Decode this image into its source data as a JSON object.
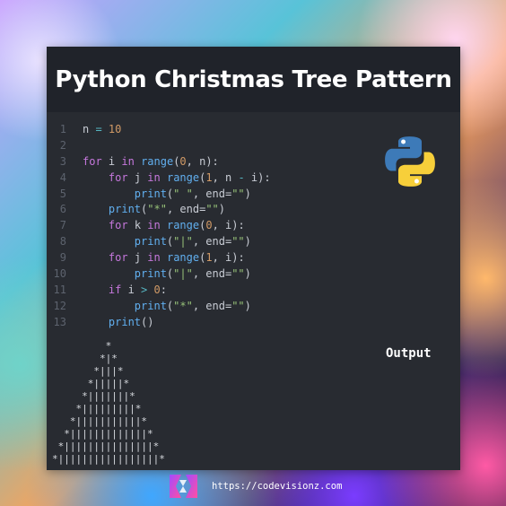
{
  "title": "Python Christmas Tree Pattern",
  "code": {
    "lines": [
      {
        "num": "1",
        "tokens": [
          {
            "t": "n ",
            "c": ""
          },
          {
            "t": "=",
            "c": "op"
          },
          {
            "t": " ",
            "c": ""
          },
          {
            "t": "10",
            "c": "num"
          }
        ]
      },
      {
        "num": "2",
        "tokens": []
      },
      {
        "num": "3",
        "tokens": [
          {
            "t": "for",
            "c": "kw"
          },
          {
            "t": " i ",
            "c": ""
          },
          {
            "t": "in",
            "c": "kw"
          },
          {
            "t": " ",
            "c": ""
          },
          {
            "t": "range",
            "c": "fn"
          },
          {
            "t": "(",
            "c": ""
          },
          {
            "t": "0",
            "c": "num"
          },
          {
            "t": ", n):",
            "c": ""
          }
        ]
      },
      {
        "num": "4",
        "tokens": [
          {
            "t": "    ",
            "c": ""
          },
          {
            "t": "for",
            "c": "kw"
          },
          {
            "t": " j ",
            "c": ""
          },
          {
            "t": "in",
            "c": "kw"
          },
          {
            "t": " ",
            "c": ""
          },
          {
            "t": "range",
            "c": "fn"
          },
          {
            "t": "(",
            "c": ""
          },
          {
            "t": "1",
            "c": "num"
          },
          {
            "t": ", n ",
            "c": ""
          },
          {
            "t": "-",
            "c": "op"
          },
          {
            "t": " i):",
            "c": ""
          }
        ]
      },
      {
        "num": "5",
        "tokens": [
          {
            "t": "        ",
            "c": ""
          },
          {
            "t": "print",
            "c": "fn"
          },
          {
            "t": "(",
            "c": ""
          },
          {
            "t": "\" \"",
            "c": "str"
          },
          {
            "t": ", end=",
            "c": ""
          },
          {
            "t": "\"\"",
            "c": "str"
          },
          {
            "t": ")",
            "c": ""
          }
        ]
      },
      {
        "num": "6",
        "tokens": [
          {
            "t": "    ",
            "c": ""
          },
          {
            "t": "print",
            "c": "fn"
          },
          {
            "t": "(",
            "c": ""
          },
          {
            "t": "\"*\"",
            "c": "str"
          },
          {
            "t": ", end=",
            "c": ""
          },
          {
            "t": "\"\"",
            "c": "str"
          },
          {
            "t": ")",
            "c": ""
          }
        ]
      },
      {
        "num": "7",
        "tokens": [
          {
            "t": "    ",
            "c": ""
          },
          {
            "t": "for",
            "c": "kw"
          },
          {
            "t": " k ",
            "c": ""
          },
          {
            "t": "in",
            "c": "kw"
          },
          {
            "t": " ",
            "c": ""
          },
          {
            "t": "range",
            "c": "fn"
          },
          {
            "t": "(",
            "c": ""
          },
          {
            "t": "0",
            "c": "num"
          },
          {
            "t": ", i):",
            "c": ""
          }
        ]
      },
      {
        "num": "8",
        "tokens": [
          {
            "t": "        ",
            "c": ""
          },
          {
            "t": "print",
            "c": "fn"
          },
          {
            "t": "(",
            "c": ""
          },
          {
            "t": "\"|\"",
            "c": "str"
          },
          {
            "t": ", end=",
            "c": ""
          },
          {
            "t": "\"\"",
            "c": "str"
          },
          {
            "t": ")",
            "c": ""
          }
        ]
      },
      {
        "num": "9",
        "tokens": [
          {
            "t": "    ",
            "c": ""
          },
          {
            "t": "for",
            "c": "kw"
          },
          {
            "t": " j ",
            "c": ""
          },
          {
            "t": "in",
            "c": "kw"
          },
          {
            "t": " ",
            "c": ""
          },
          {
            "t": "range",
            "c": "fn"
          },
          {
            "t": "(",
            "c": ""
          },
          {
            "t": "1",
            "c": "num"
          },
          {
            "t": ", i):",
            "c": ""
          }
        ]
      },
      {
        "num": "10",
        "tokens": [
          {
            "t": "        ",
            "c": ""
          },
          {
            "t": "print",
            "c": "fn"
          },
          {
            "t": "(",
            "c": ""
          },
          {
            "t": "\"|\"",
            "c": "str"
          },
          {
            "t": ", end=",
            "c": ""
          },
          {
            "t": "\"\"",
            "c": "str"
          },
          {
            "t": ")",
            "c": ""
          }
        ]
      },
      {
        "num": "11",
        "tokens": [
          {
            "t": "    ",
            "c": ""
          },
          {
            "t": "if",
            "c": "kw"
          },
          {
            "t": " i ",
            "c": ""
          },
          {
            "t": ">",
            "c": "op"
          },
          {
            "t": " ",
            "c": ""
          },
          {
            "t": "0",
            "c": "num"
          },
          {
            "t": ":",
            "c": ""
          }
        ]
      },
      {
        "num": "12",
        "tokens": [
          {
            "t": "        ",
            "c": ""
          },
          {
            "t": "print",
            "c": "fn"
          },
          {
            "t": "(",
            "c": ""
          },
          {
            "t": "\"*\"",
            "c": "str"
          },
          {
            "t": ", end=",
            "c": ""
          },
          {
            "t": "\"\"",
            "c": "str"
          },
          {
            "t": ")",
            "c": ""
          }
        ]
      },
      {
        "num": "13",
        "tokens": [
          {
            "t": "    ",
            "c": ""
          },
          {
            "t": "print",
            "c": "fn"
          },
          {
            "t": "()",
            "c": ""
          }
        ]
      }
    ]
  },
  "output": {
    "label": "Output",
    "lines": [
      "         *",
      "        *|*",
      "       *|||*",
      "      *|||||*",
      "     *|||||||*",
      "    *|||||||||*",
      "   *|||||||||||*",
      "  *|||||||||||||*",
      " *|||||||||||||||*",
      "*|||||||||||||||||*"
    ]
  },
  "footer": {
    "url": "https://codevisionz.com"
  },
  "icons": {
    "python_logo": "python-logo-icon",
    "brand_logo": "codevisionz-logo-icon"
  },
  "colors": {
    "card_bg": "#282b31",
    "title_bg": "#20232a",
    "keyword": "#c678dd",
    "function": "#61afef",
    "number": "#d19a66",
    "string": "#98c379",
    "operator": "#56b6c2"
  }
}
